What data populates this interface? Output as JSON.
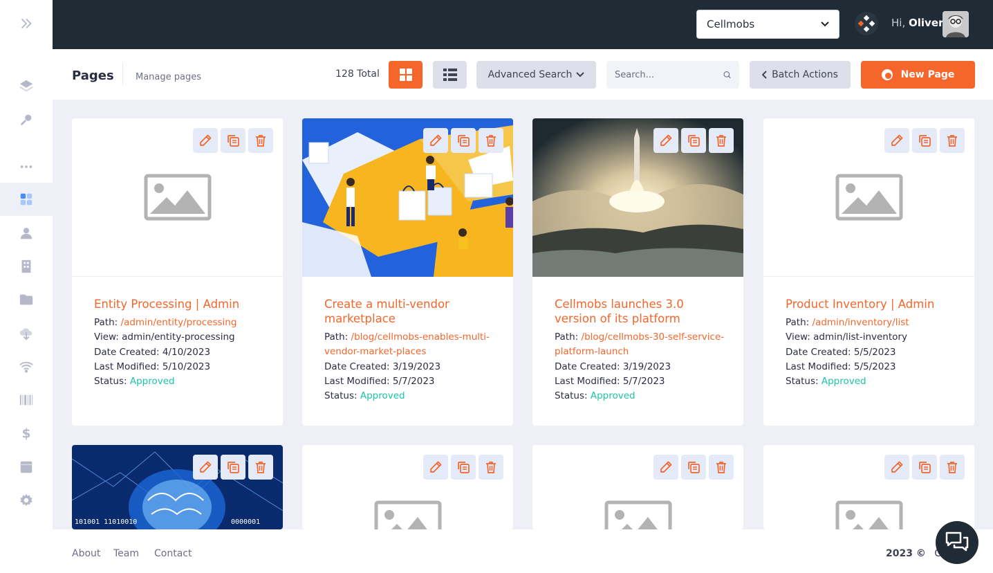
{
  "topbar": {
    "company_selected": "Cellmobs",
    "greeting_prefix": "Hi,",
    "user_name": "Oliver"
  },
  "header": {
    "title": "Pages",
    "subtitle": "Manage pages",
    "total": "128 Total",
    "advanced_search": "Advanced Search",
    "search_placeholder": "Search...",
    "batch_actions": "Batch Actions",
    "new_page": "New Page"
  },
  "sidebar": {
    "items": [
      "collapse-icon",
      "layers-icon",
      "key-icon",
      "more-icon",
      "dashboard-icon",
      "user-icon",
      "building-icon",
      "folder-icon",
      "cloud-download-icon",
      "wifi-icon",
      "barcode-icon",
      "dollar-icon",
      "archive-icon",
      "gear-icon"
    ],
    "active": "dashboard-icon"
  },
  "labels": {
    "path": "Path:",
    "view": "View:",
    "date_created": "Date Created:",
    "last_modified": "Last Modified:",
    "status": "Status:"
  },
  "cards": [
    {
      "title": "Entity Processing | Admin",
      "path": "/admin/entity/processing",
      "view": "admin/entity-processing",
      "date_created": "4/10/2023",
      "last_modified": "5/10/2023",
      "status": "Approved",
      "image": "placeholder"
    },
    {
      "title": "Create a multi-vendor marketplace",
      "path": "/blog/cellmobs-enables-multi-vendor-market-places",
      "date_created": "3/19/2023",
      "last_modified": "5/7/2023",
      "status": "Approved",
      "image": "puzzle-illustration"
    },
    {
      "title": "Cellmobs launches 3.0 version of its platform",
      "path": "/blog/cellmobs-30-self-service-platform-launch",
      "date_created": "3/19/2023",
      "last_modified": "5/7/2023",
      "status": "Approved",
      "image": "rocket-launch-photo"
    },
    {
      "title": "Product Inventory | Admin",
      "path": "/admin/inventory/list",
      "view": "admin/list-inventory",
      "date_created": "5/5/2023",
      "last_modified": "5/5/2023",
      "status": "Approved",
      "image": "placeholder"
    },
    {
      "image": "ai-brain-photo"
    },
    {
      "image": "placeholder"
    },
    {
      "image": "placeholder"
    },
    {
      "image": "placeholder"
    }
  ],
  "footer": {
    "links": [
      "About",
      "Team",
      "Contact"
    ],
    "year": "2023 ©",
    "brand_partial": "Ce"
  },
  "colors": {
    "accent": "#f4662b",
    "topbar": "#1f2b35",
    "status_approved": "#1bc5a5"
  }
}
